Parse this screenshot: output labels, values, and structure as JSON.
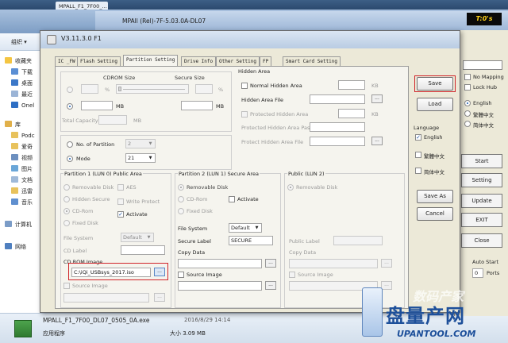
{
  "taskbar": {
    "tab_title": "MPALL_F1_7F00_..."
  },
  "explorer": {
    "organize": "组织 ▾",
    "nav_items": [
      "收藏夹",
      "下载",
      "桌面",
      "最近",
      "Onel",
      "库",
      "Podc",
      "爱奇",
      "视频",
      "图片",
      "文档",
      "迅雷",
      "音乐",
      "计算机",
      "网络"
    ],
    "footer_file": "MPALL_F1_7F00_DL07_0505_0A.exe",
    "footer_type": "应用程序",
    "footer_date": "2016/8/29 14:14",
    "footer_size_label": "大小 3.09 MB"
  },
  "bg_window": {
    "title": "MPAll (Rel)-7F-5.03.0A-DL07",
    "time": "T:0's",
    "no_mapping": "No Mapping",
    "lock_hub": "Lock Hub",
    "lang_english": "English",
    "lang_trad": "繁體中文",
    "lang_simp": "简体中文",
    "start": "Start",
    "setting": "Setting",
    "update": "Update",
    "exit": "EXIT",
    "close": "Close",
    "auto_start": "Auto Start",
    "ports": "Ports",
    "port_value": "0"
  },
  "dialog": {
    "version": "V3.11.3.0 F1",
    "tabs": [
      "IC _FW",
      "Flash Setting",
      "Partition Setting",
      "Drive Info",
      "Other Setting",
      "FP",
      "Smart Card Setting"
    ],
    "cdrom": {
      "cdrom_size": "CDROM Size",
      "secure_size": "Secure Size",
      "percent": "%",
      "mb": "MB",
      "total_capacity": "Total Capacity",
      "no_of_partition": "No. of Partition",
      "partition_count": "2",
      "mode": "Mode",
      "mode_value": "21"
    },
    "hidden_area": {
      "title": "Hidden Area",
      "normal": "Normal Hidden Area",
      "kb": "KB",
      "hidden_area_file": "Hidden Area File",
      "protected": "Protected Hidden Area",
      "protected_password": "Protected Hidden Area Password",
      "protected_file": "Protect Hidden Area File",
      "browse": "..."
    },
    "partition1": {
      "title": "Partition 1 (LUN 0) Public Area",
      "removable": "Removable Disk",
      "aes": "AES",
      "hidden_secure": "Hidden Secure",
      "write_protect": "Write Protect",
      "cdrom": "CD-Rom",
      "activate": "Activate",
      "fixed": "Fixed Disk",
      "file_system": "File System",
      "file_system_value": "Default",
      "cd_label": "CD Label",
      "cd_rom_image": "CD ROM Image",
      "cd_rom_image_value": "C:\\iQi_USBsys_2017.iso",
      "source_image": "Source Image"
    },
    "partition2": {
      "title": "Partition 2 (LUN 1) Secure Area",
      "removable": "Removable Disk",
      "cdrom": "CD-Rom",
      "activate": "Activate",
      "fixed": "Fixed Disk",
      "file_system": "File System",
      "file_system_value": "Default",
      "secure_label": "Secure Label",
      "secure_label_value": "SECURE",
      "copy_data": "Copy Data",
      "source_image": "Source Image"
    },
    "public_lun2": {
      "title": "Public (LUN 2)",
      "removable": "Removable Disk",
      "public_label": "Public Label",
      "copy_data": "Copy Data",
      "source_image": "Source Image"
    },
    "buttons": {
      "save": "Save",
      "load": "Load",
      "language": "Language",
      "english": "English",
      "trad_chinese": "繁體中文",
      "simp_chinese": "简体中文",
      "save_as": "Save As",
      "cancel": "Cancel"
    }
  },
  "watermark": {
    "cn": "数码产家",
    "big": "盘量产网",
    "url": "UPANTOOL.COM"
  },
  "colors": {
    "highlight_red": "#d0242a",
    "title_blue": "#b9cce3"
  }
}
